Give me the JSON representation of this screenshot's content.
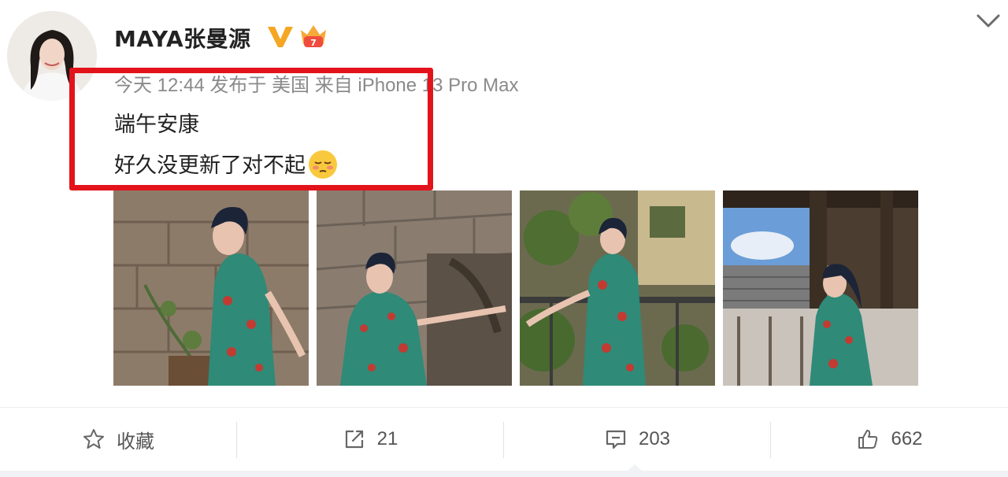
{
  "post": {
    "username": "MAYA张曼源",
    "meta": "今天 12:44 发布于 美国 来自 iPhone 13 Pro Max",
    "text_line1": "端午安康",
    "text_line2": "好久没更新了对不起"
  },
  "actions": {
    "favorite_label": "收藏",
    "repost_count": "21",
    "comment_count": "203",
    "like_count": "662"
  },
  "colors": {
    "highlight_box": "#e3131b",
    "verified_badge": "#f5a623",
    "dress": "#2f8a78"
  },
  "icons": [
    "chevron-down-icon",
    "verified-v-icon",
    "crown-badge-icon",
    "star-icon",
    "repost-icon",
    "comment-icon",
    "thumbs-up-icon",
    "emoji-icon"
  ]
}
